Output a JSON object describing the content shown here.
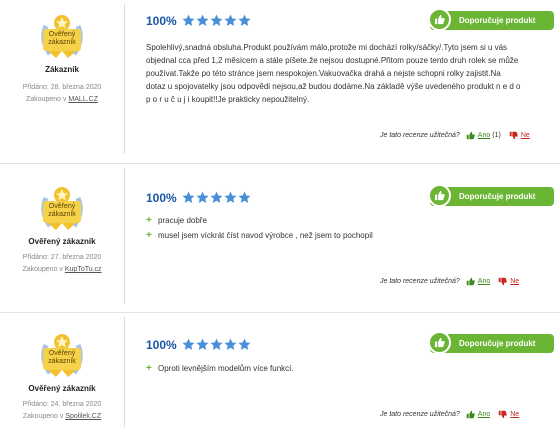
{
  "reviews": [
    {
      "author": "Zákazník",
      "badge": "Ověřený zákazník",
      "date": "Přidáno: 28. března 2020",
      "bought_prefix": "Zakoupeno v ",
      "shop": "MALL.CZ",
      "percent": "100%",
      "rating_stars": 5,
      "recommend": "Doporučuje produkt",
      "text": "Spolehlivý,snadná obsluha.Produkt používám málo,protože mi dochází rolky/sáčky/.Tyto jsem si u vás objednal cca před 1,2 měsícem a stále píšete.že nejsou dostupné.Přitom pouze tento druh rolek se může používat.Takže po této stránce jsem nespokojen.Vakuovačka drahá a nejste schopni rolky zajistit.Na dotaz u spojovatelky jsou odpovědi nejsou,až budou dodáme.Na základě výše uvedeného produkt n e d o p o r u č u j i koupit!!Je prakticky nepoužitelný.",
      "helpful_q": "Je tato recenze užitečná?",
      "yes": "Ano",
      "yes_count": "(1)",
      "no": "Ne"
    },
    {
      "author": "Ověřený zákazník",
      "badge": "Ověřený zákazník",
      "date": "Přidáno: 27. března 2020",
      "bought_prefix": "Zakoupeno v ",
      "shop": "KupToTu.cz",
      "percent": "100%",
      "rating_stars": 5,
      "recommend": "Doporučuje produkt",
      "pros": [
        "pracuje dobře",
        "musel jsem víckrát číst navod výrobce , než jsem to pochopil"
      ],
      "helpful_q": "Je tato recenze užitečná?",
      "yes": "Ano",
      "no": "Ne"
    },
    {
      "author": "Ověřený zákazník",
      "badge": "Ověřený zákazník",
      "date": "Přidáno: 24. března 2020",
      "bought_prefix": "Zakoupeno v ",
      "shop": "Spolilek.CZ",
      "percent": "100%",
      "rating_stars": 5,
      "recommend": "Doporučuje produkt",
      "pros": [
        "Oproti levnějším modelům více funkcí."
      ],
      "helpful_q": "Je tato recenze užitečná?",
      "yes": "Ano",
      "no": "Ne"
    }
  ],
  "colors": {
    "accent": "#6bb534",
    "percent": "#1a56a6",
    "star": "#4a90d9",
    "yes": "#3a8a1c",
    "no": "#c8261c"
  },
  "icons": {
    "recommend": "thumbs-up-icon",
    "star": "star-icon",
    "pro": "plus-icon",
    "yes": "thumbs-up-icon",
    "no": "thumbs-down-icon"
  }
}
